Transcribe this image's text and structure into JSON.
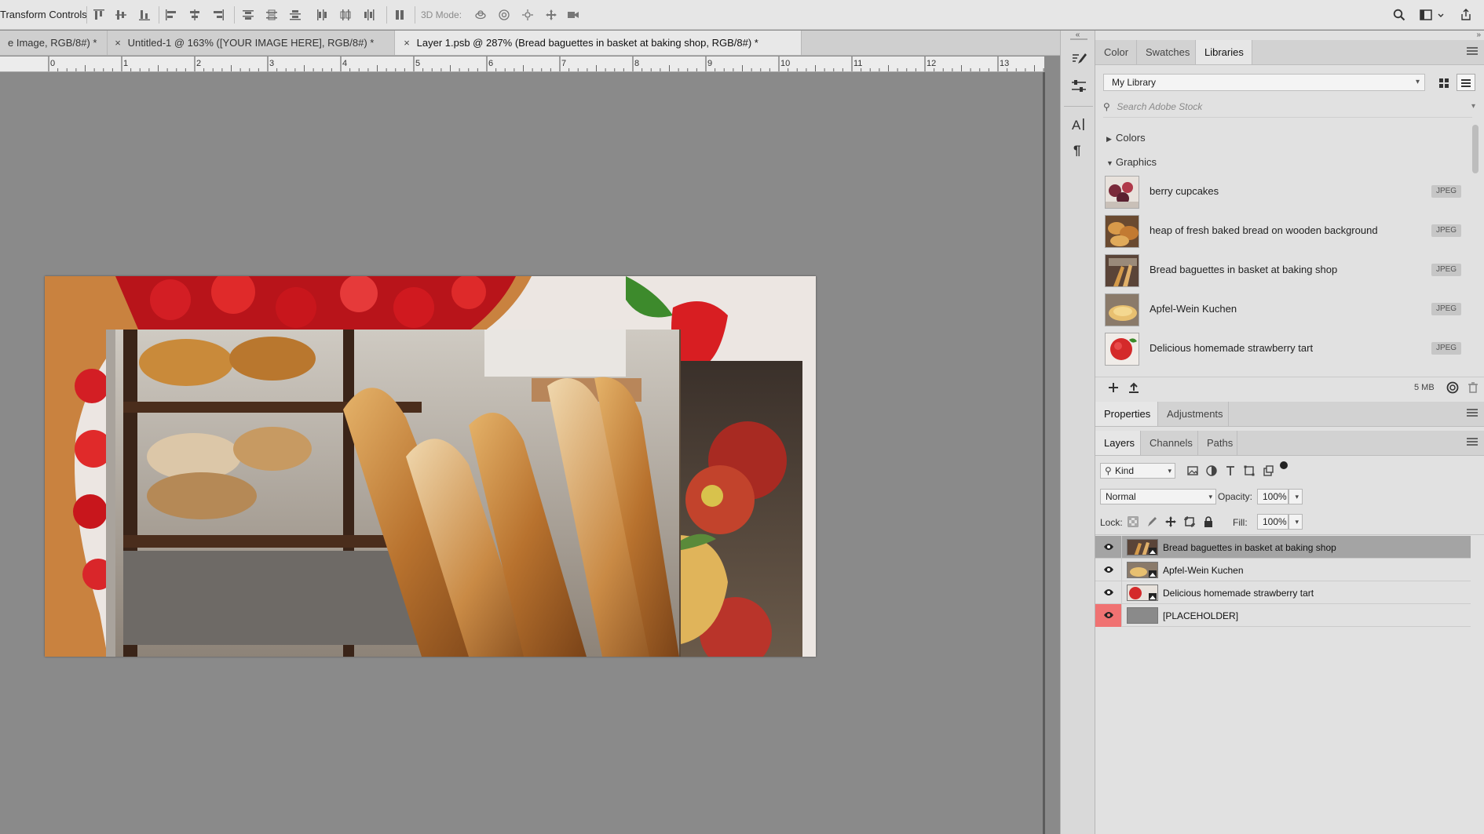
{
  "options_bar": {
    "label": "Transform Controls",
    "mode_3d_label": "3D Mode:"
  },
  "document_tabs": [
    {
      "label": "e Image, RGB/8#) *"
    },
    {
      "label": "Untitled-1 @ 163% ([YOUR IMAGE HERE], RGB/8#) *"
    },
    {
      "label": "Layer 1.psb @ 287% (Bread baguettes in basket at baking shop, RGB/8#) *"
    }
  ],
  "ruler": {
    "labels": [
      "0",
      "1",
      "2",
      "3",
      "4",
      "5",
      "6",
      "7",
      "8",
      "9",
      "10",
      "11",
      "12",
      "13"
    ]
  },
  "top_panel": {
    "tabs": [
      {
        "label": "Color"
      },
      {
        "label": "Swatches"
      },
      {
        "label": "Libraries"
      }
    ],
    "library_select": "My Library",
    "search_placeholder": "Search Adobe Stock",
    "sections": {
      "colors": "Colors",
      "graphics": "Graphics"
    },
    "items": [
      {
        "name": "berry cupcakes",
        "badge": "JPEG"
      },
      {
        "name": "heap of fresh baked bread on wooden background",
        "badge": "JPEG"
      },
      {
        "name": "Bread baguettes in basket at baking shop",
        "badge": "JPEG"
      },
      {
        "name": "Apfel-Wein Kuchen",
        "badge": "JPEG"
      },
      {
        "name": "Delicious homemade strawberry tart",
        "badge": "JPEG"
      }
    ],
    "storage_used": "5 MB"
  },
  "properties_panel": {
    "tabs": [
      {
        "label": "Properties"
      },
      {
        "label": "Adjustments"
      }
    ]
  },
  "layers_panel": {
    "tabs": [
      {
        "label": "Layers"
      },
      {
        "label": "Channels"
      },
      {
        "label": "Paths"
      }
    ],
    "filter_kind": "Kind",
    "blend_mode": "Normal",
    "opacity_label": "Opacity:",
    "opacity_value": "100%",
    "lock_label": "Lock:",
    "fill_label": "Fill:",
    "fill_value": "100%",
    "layers": [
      {
        "name": "Bread baguettes in basket at baking shop"
      },
      {
        "name": "Apfel-Wein Kuchen"
      },
      {
        "name": "Delicious homemade strawberry tart"
      },
      {
        "name": "[PLACEHOLDER]"
      }
    ]
  },
  "colors": {
    "placeholder_eye_bg": "#f07272",
    "selected_layer_bg": "#a4a4a4",
    "canvas_bg": "#8a8a8a"
  }
}
